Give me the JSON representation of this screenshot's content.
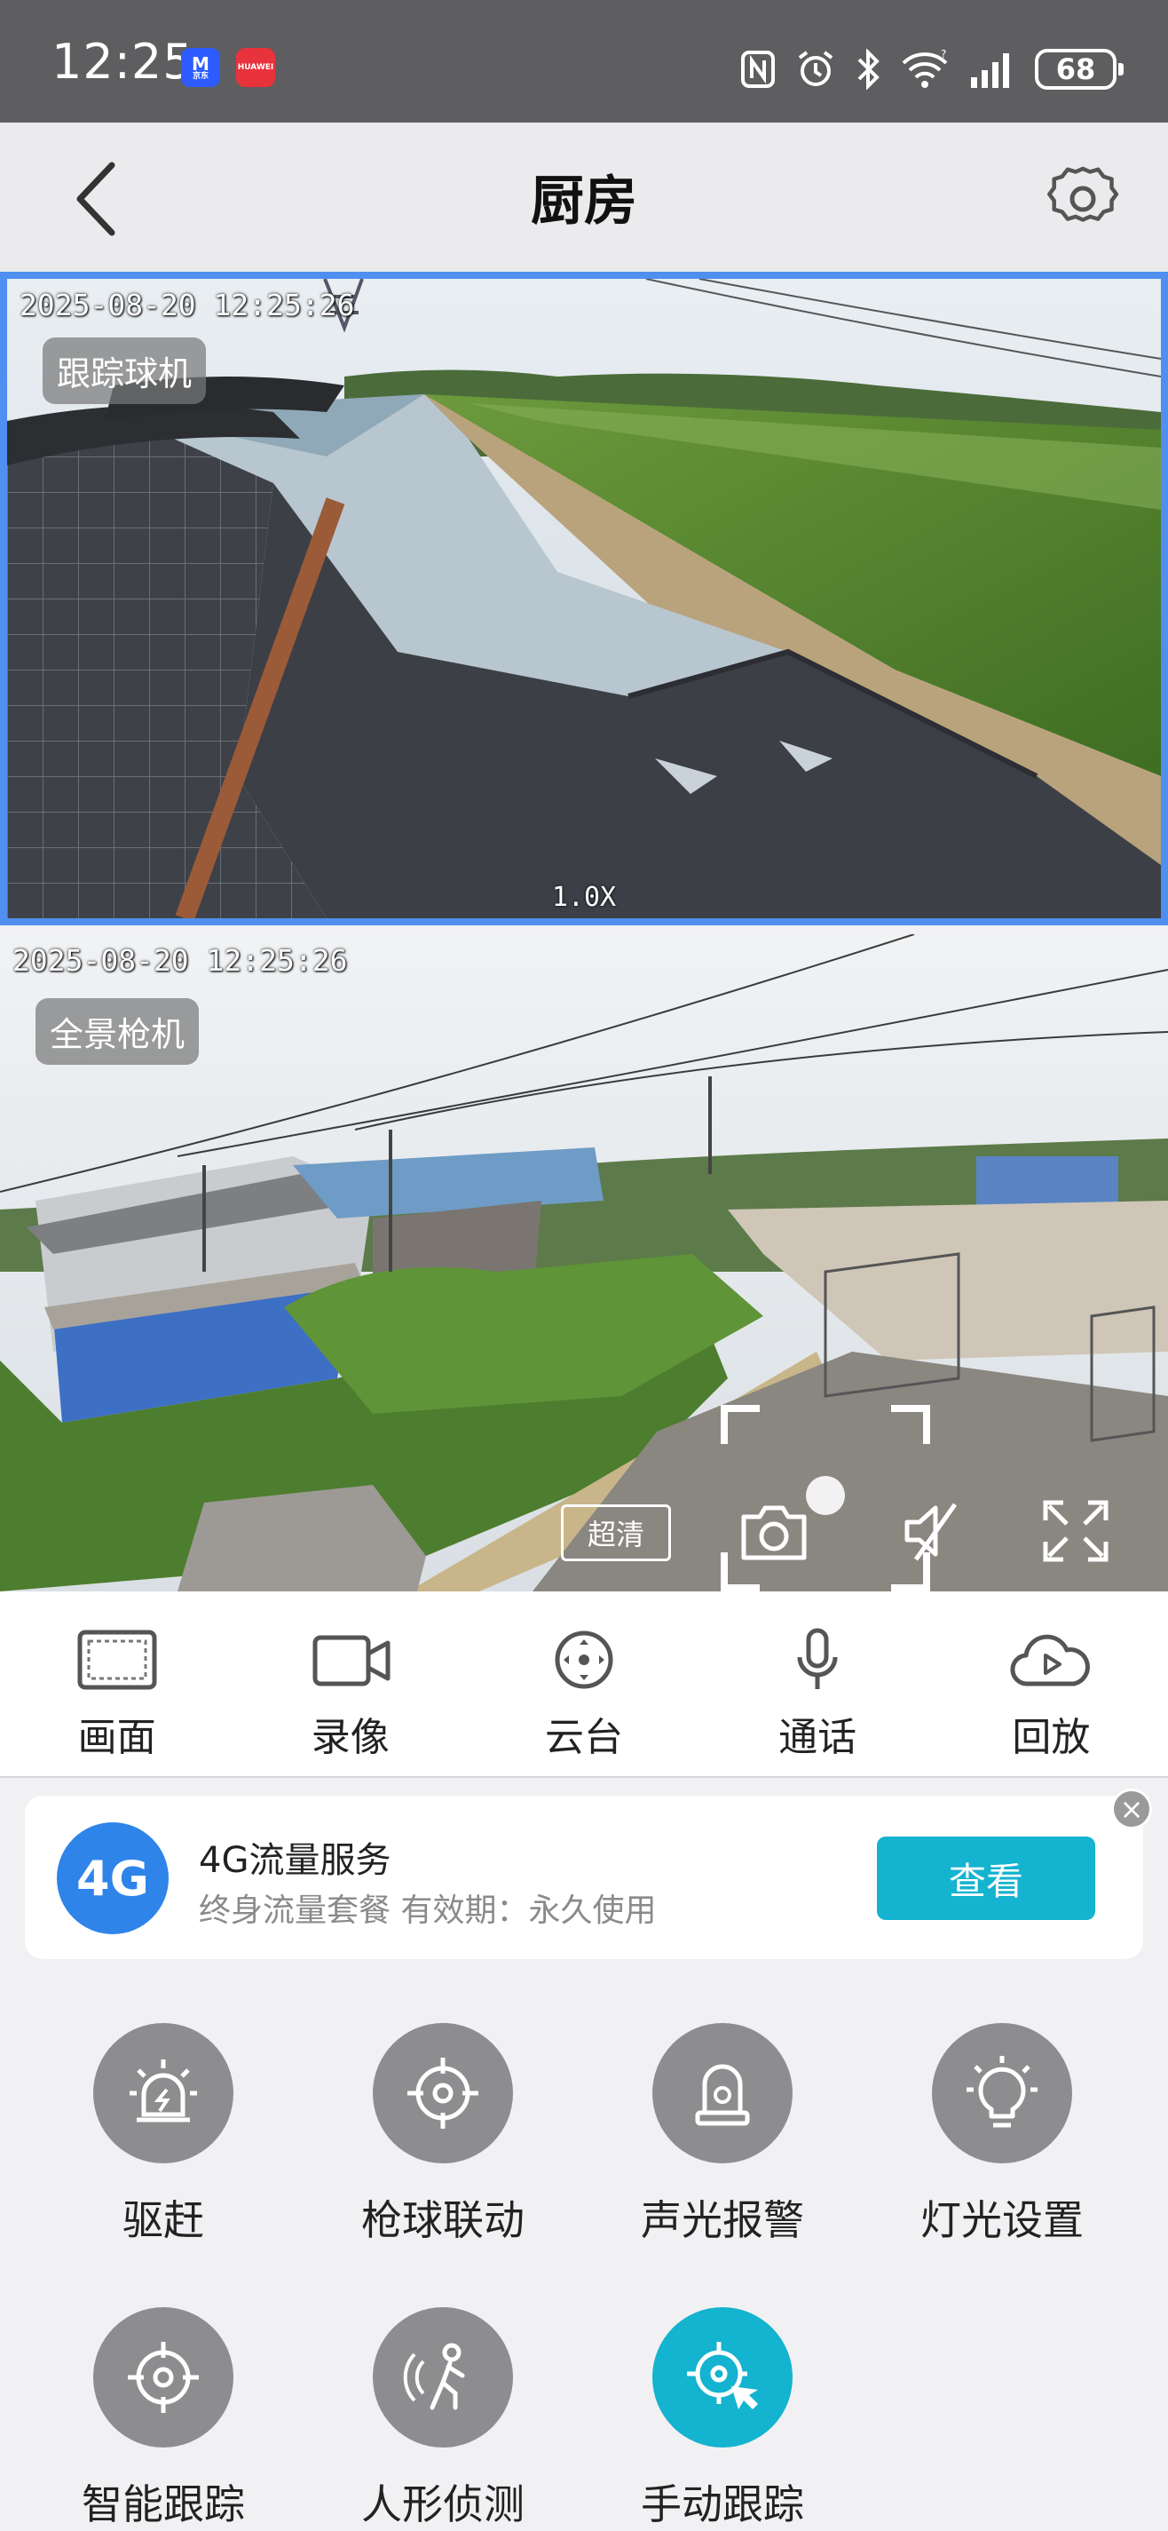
{
  "status_bar": {
    "time": "12:25",
    "apps": [
      "京东",
      "HUAWEI"
    ],
    "icons": [
      "nfc-icon",
      "alarm-icon",
      "bluetooth-icon",
      "wifi-icon",
      "signal-icon"
    ],
    "battery": "68"
  },
  "header": {
    "title": "厨房"
  },
  "cameras": [
    {
      "label": "跟踪球机",
      "timestamp": "2025-08-20  12:25:26",
      "zoom": "1.0X"
    },
    {
      "label": "全景枪机",
      "timestamp": "2025-08-20  12:25:26",
      "quality": "超清"
    }
  ],
  "toolbar": [
    {
      "label": "画面",
      "icon": "screen-icon"
    },
    {
      "label": "录像",
      "icon": "video-camera-icon"
    },
    {
      "label": "云台",
      "icon": "ptz-icon"
    },
    {
      "label": "通话",
      "icon": "microphone-icon"
    },
    {
      "label": "回放",
      "icon": "cloud-play-icon"
    }
  ],
  "service_card": {
    "logo_text": "4G",
    "title": "4G流量服务",
    "subtitle": "终身流量套餐 有效期：永久使用",
    "button": "查看"
  },
  "features": [
    {
      "label": "驱赶",
      "icon": "alarm-light-icon",
      "active": false
    },
    {
      "label": "枪球联动",
      "icon": "target-icon",
      "active": false
    },
    {
      "label": "声光报警",
      "icon": "siren-icon",
      "active": false
    },
    {
      "label": "灯光设置",
      "icon": "bulb-icon",
      "active": false
    },
    {
      "label": "智能跟踪",
      "icon": "target-icon",
      "active": false
    },
    {
      "label": "人形侦测",
      "icon": "person-detect-icon",
      "active": false
    },
    {
      "label": "手动跟踪",
      "icon": "manual-track-icon",
      "active": true
    }
  ],
  "colors": {
    "accent": "#14b3cf",
    "selected_border": "#4f8ff0",
    "status_bar": "#5e5e60",
    "icon_circle": "#8d8d8f",
    "4g_logo": "#2f84ea"
  }
}
